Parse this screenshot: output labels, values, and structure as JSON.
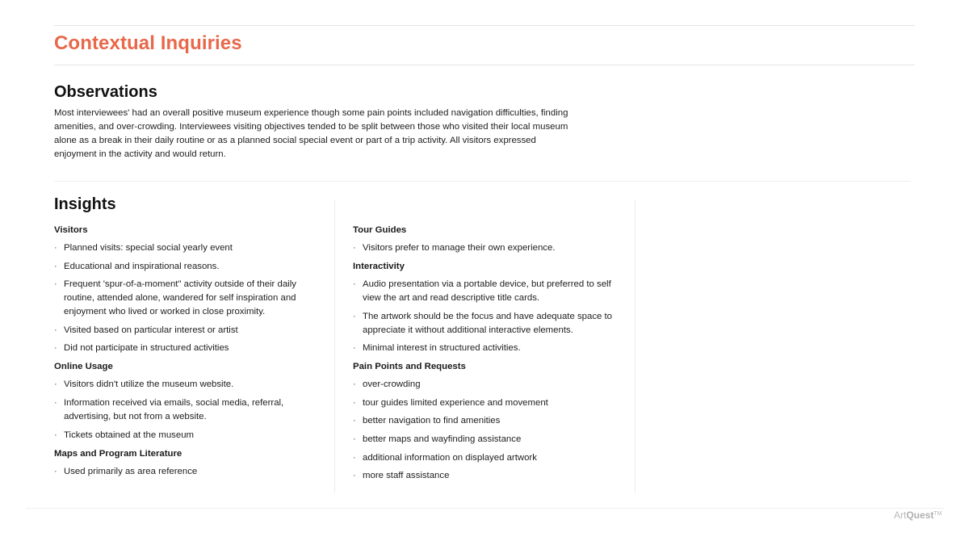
{
  "page": {
    "title": "Contextual Inquiries",
    "accent_color": "#e8684a"
  },
  "observations": {
    "heading": "Observations",
    "text": "Most interviewees' had an overall positive museum experience though some pain points included navigation difficulties, finding amenities, and over-crowding. Interviewees visiting objectives tended to be split between those who visited their local museum alone as a break in their daily routine or as a planned social special event or part of a trip activity. All visitors expressed enjoyment in the activity and would return."
  },
  "insights": {
    "heading": "Insights",
    "bullet": "·",
    "column1": [
      {
        "title": "Visitors",
        "items": [
          "Planned visits: special social yearly event",
          "Educational and inspirational reasons.",
          "Frequent 'spur-of-a-moment\" activity outside of their daily routine, attended alone, wandered for self inspiration and enjoyment who lived or worked in close proximity.",
          "Visited based on particular interest or artist",
          "Did not participate in structured activities"
        ]
      },
      {
        "title": "Online Usage",
        "items": [
          "Visitors didn't utilize the museum website.",
          "Information received via emails, social media, referral, advertising, but not from a website.",
          "Tickets obtained at the museum"
        ]
      },
      {
        "title": "Maps and Program Literature",
        "items": [
          "Used primarily as area reference"
        ]
      }
    ],
    "column2": [
      {
        "title": "Tour Guides",
        "items": [
          "Visitors prefer to manage their own experience."
        ]
      },
      {
        "title": "Interactivity",
        "items": [
          "Audio presentation via a portable device, but preferred to self view the art and read descriptive title cards.",
          "The artwork should be the focus and have adequate space to appreciate it without additional interactive elements.",
          "Minimal interest in structured activities."
        ]
      },
      {
        "title": "Pain Points and Requests",
        "items": [
          "over-crowding",
          "tour guides limited experience and movement",
          "better navigation to find amenities",
          "better maps and wayfinding assistance",
          "additional information on displayed artwork",
          "more staff assistance"
        ]
      }
    ]
  },
  "footer": {
    "brand_light": "Art",
    "brand_bold": "Quest",
    "brand_mark": "TM"
  }
}
